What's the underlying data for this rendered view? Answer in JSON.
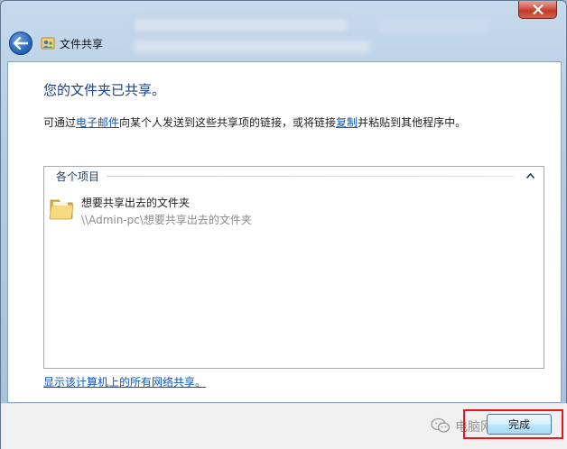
{
  "window": {
    "breadcrumb_title": "文件共享",
    "close_icon": "close-icon",
    "back_icon": "back-arrow-icon"
  },
  "content": {
    "heading": "您的文件夹已共享。",
    "desc_before": "可通过",
    "email_link": "电子邮件",
    "desc_middle": "向某个人发送到这些共享项的链接，或将链接",
    "copy_link": "复制",
    "desc_after": "并粘贴到其他程序中。",
    "group_title": "各个项目",
    "items": [
      {
        "name": "想要共享出去的文件夹",
        "path": "\\\\Admin-pc\\想要共享出去的文件夹",
        "icon": "folder-icon"
      }
    ],
    "show_all_link": "显示该计算机上的所有网络共享。"
  },
  "footer": {
    "done_label": "完成",
    "watermark": "电脑网络帮手",
    "watermark_icon": "wechat-icon"
  },
  "colors": {
    "heading": "#1b3f8c",
    "link": "#0b55c4",
    "highlight": "#e8141b"
  }
}
